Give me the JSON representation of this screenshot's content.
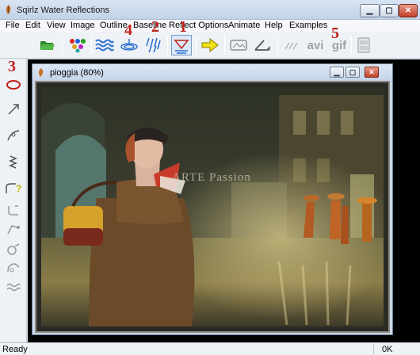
{
  "window": {
    "title": "Sqirlz Water Reflections"
  },
  "menu": [
    "File",
    "Edit",
    "View",
    "Image",
    "Outline",
    "Baseline",
    "Reflect Options",
    "Animate",
    "Help",
    "Examples"
  ],
  "toolbar": {
    "open_icon": "folder-open-icon",
    "color_icon": "color-dots-icon",
    "ripple_icon": "ripple-waves-icon",
    "ellipse_icon": "ellipse-rings-icon",
    "rain_icon": "rain-streaks-icon",
    "drip_icon": "drip-reflect-icon",
    "arrow_icon": "yellow-arrow-icon",
    "avi_label": "avi",
    "gif_label": "gif"
  },
  "annotations": {
    "n1": "1",
    "n2": "2",
    "n3": "3",
    "n4": "4",
    "n5": "5"
  },
  "child": {
    "title": "pioggia  (80%)"
  },
  "canvas": {
    "watermark": "ARTE Passion"
  },
  "status": {
    "left": "Ready",
    "right": "0K"
  },
  "colors": {
    "accent_red": "#c0201a",
    "titlebar": "#c2d3e8"
  }
}
